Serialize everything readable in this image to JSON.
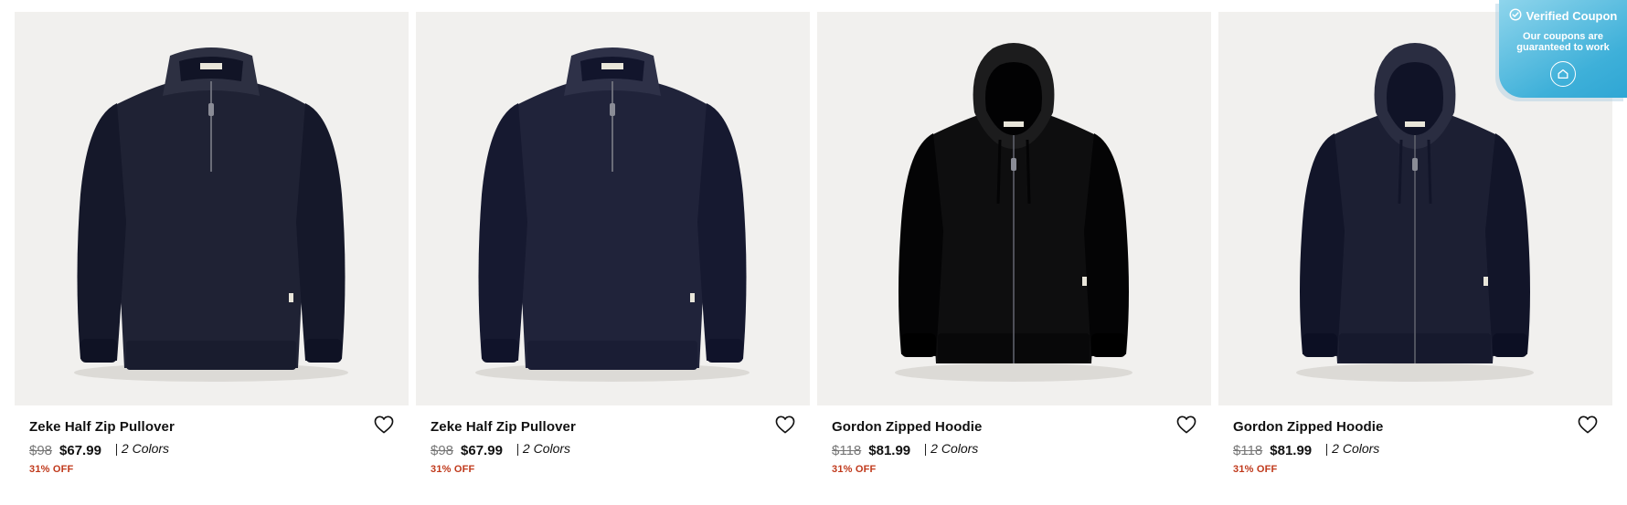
{
  "products": [
    {
      "name": "Zeke Half Zip Pullover",
      "old_price": "$98",
      "price": "$67.99",
      "colors": "2 Colors",
      "discount": "31% OFF",
      "garment": "half-zip",
      "garment_color": "#1f2234"
    },
    {
      "name": "Zeke Half Zip Pullover",
      "old_price": "$98",
      "price": "$67.99",
      "colors": "2 Colors",
      "discount": "31% OFF",
      "garment": "half-zip",
      "garment_color": "#20233a"
    },
    {
      "name": "Gordon Zipped Hoodie",
      "old_price": "$118",
      "price": "$81.99",
      "colors": "2 Colors",
      "discount": "31% OFF",
      "garment": "hoodie",
      "garment_color": "#0e0e0f"
    },
    {
      "name": "Gordon Zipped Hoodie",
      "old_price": "$118",
      "price": "$81.99",
      "colors": "2 Colors",
      "discount": "31% OFF",
      "garment": "hoodie",
      "garment_color": "#1c1f33"
    }
  ],
  "coupon": {
    "title": "Verified Coupon",
    "subtitle": "Our coupons are guaranteed to work"
  },
  "icons": {
    "wishlist": "heart-outline-icon",
    "verified": "check-circle-icon",
    "home": "home-icon"
  },
  "colors": {
    "discount": "#c0391b",
    "image_bg": "#f1f0ee",
    "coupon_blue": "#3eb0d9"
  }
}
